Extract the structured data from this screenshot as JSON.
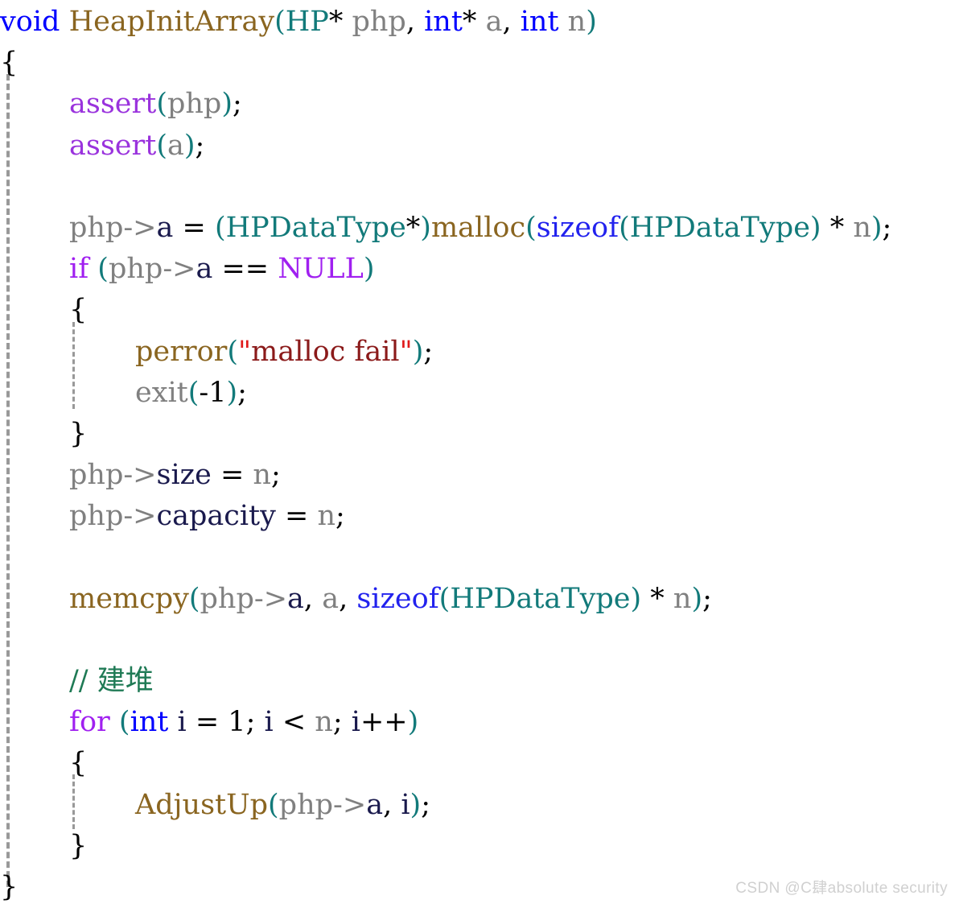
{
  "editor": {
    "language": "C",
    "background": "#ffffff",
    "font_size_px": 35,
    "line_height_px": 51.2,
    "indent_guide_color": "#999999"
  },
  "palette": {
    "keyword": "#0000ff",
    "control": "#a020f0",
    "macro": "#9a33dd",
    "function": "#8a6520",
    "type": "#127a7a",
    "variable": "#808080",
    "member": "#1a1a4d",
    "punctuation": "#000000",
    "sizeof": "#2222ee",
    "string": "#8b1a1a",
    "string_quote": "#e01b1b",
    "comment": "#1f7a55",
    "watermark": "#d0d0d0"
  },
  "watermark": {
    "text": "CSDN @C肆absolute security"
  },
  "code": {
    "plain_text": "void HeapInitArray(HP* php, int* a, int n)\n{\n    assert(php);\n    assert(a);\n\n    php->a = (HPDataType*)malloc(sizeof(HPDataType) * n);\n    if (php->a == NULL)\n    {\n        perror(\"malloc fail\");\n        exit(-1);\n    }\n    php->size = n;\n    php->capacity = n;\n\n    memcpy(php->a, a, sizeof(HPDataType) * n);\n\n    // 建堆\n    for (int i = 1; i < n; i++)\n    {\n        AdjustUp(php->a, i);\n    }\n}",
    "lines": [
      {
        "indent": 0,
        "tokens": [
          {
            "text": "void",
            "kind": "keyword"
          },
          {
            "text": " ",
            "kind": "plain"
          },
          {
            "text": "HeapInitArray",
            "kind": "function"
          },
          {
            "text": "(",
            "kind": "paren"
          },
          {
            "text": "HP",
            "kind": "type"
          },
          {
            "text": "*",
            "kind": "punct"
          },
          {
            "text": " ",
            "kind": "plain"
          },
          {
            "text": "php",
            "kind": "var"
          },
          {
            "text": ", ",
            "kind": "punct"
          },
          {
            "text": "int",
            "kind": "keyword"
          },
          {
            "text": "*",
            "kind": "punct"
          },
          {
            "text": " ",
            "kind": "plain"
          },
          {
            "text": "a",
            "kind": "var"
          },
          {
            "text": ", ",
            "kind": "punct"
          },
          {
            "text": "int",
            "kind": "keyword"
          },
          {
            "text": " ",
            "kind": "plain"
          },
          {
            "text": "n",
            "kind": "var"
          },
          {
            "text": ")",
            "kind": "paren"
          }
        ]
      },
      {
        "indent": 0,
        "tokens": [
          {
            "text": "{",
            "kind": "punct"
          }
        ]
      },
      {
        "indent": 1,
        "tokens": [
          {
            "text": "assert",
            "kind": "macro"
          },
          {
            "text": "(",
            "kind": "paren"
          },
          {
            "text": "php",
            "kind": "var"
          },
          {
            "text": ")",
            "kind": "paren"
          },
          {
            "text": ";",
            "kind": "punct"
          }
        ]
      },
      {
        "indent": 1,
        "tokens": [
          {
            "text": "assert",
            "kind": "macro"
          },
          {
            "text": "(",
            "kind": "paren"
          },
          {
            "text": "a",
            "kind": "var"
          },
          {
            "text": ")",
            "kind": "paren"
          },
          {
            "text": ";",
            "kind": "punct"
          }
        ]
      },
      {
        "indent": 0,
        "tokens": []
      },
      {
        "indent": 1,
        "tokens": [
          {
            "text": "php",
            "kind": "var"
          },
          {
            "text": "->",
            "kind": "var"
          },
          {
            "text": "a",
            "kind": "member"
          },
          {
            "text": " = ",
            "kind": "punct"
          },
          {
            "text": "(",
            "kind": "paren"
          },
          {
            "text": "HPDataType",
            "kind": "type"
          },
          {
            "text": "*",
            "kind": "punct"
          },
          {
            "text": ")",
            "kind": "paren"
          },
          {
            "text": "malloc",
            "kind": "function"
          },
          {
            "text": "(",
            "kind": "paren"
          },
          {
            "text": "sizeof",
            "kind": "sizeof"
          },
          {
            "text": "(",
            "kind": "paren"
          },
          {
            "text": "HPDataType",
            "kind": "type"
          },
          {
            "text": ")",
            "kind": "paren"
          },
          {
            "text": " * ",
            "kind": "punct"
          },
          {
            "text": "n",
            "kind": "var"
          },
          {
            "text": ")",
            "kind": "paren"
          },
          {
            "text": ";",
            "kind": "punct"
          }
        ]
      },
      {
        "indent": 1,
        "tokens": [
          {
            "text": "if",
            "kind": "control"
          },
          {
            "text": " ",
            "kind": "plain"
          },
          {
            "text": "(",
            "kind": "paren"
          },
          {
            "text": "php",
            "kind": "var"
          },
          {
            "text": "->",
            "kind": "var"
          },
          {
            "text": "a",
            "kind": "member"
          },
          {
            "text": " == ",
            "kind": "punct"
          },
          {
            "text": "NULL",
            "kind": "null"
          },
          {
            "text": ")",
            "kind": "paren"
          }
        ]
      },
      {
        "indent": 1,
        "tokens": [
          {
            "text": "{",
            "kind": "punct"
          }
        ]
      },
      {
        "indent": 2,
        "tokens": [
          {
            "text": "perror",
            "kind": "function"
          },
          {
            "text": "(",
            "kind": "paren"
          },
          {
            "text": "\"",
            "kind": "quote"
          },
          {
            "text": "malloc fail",
            "kind": "string"
          },
          {
            "text": "\"",
            "kind": "quote"
          },
          {
            "text": ")",
            "kind": "paren"
          },
          {
            "text": ";",
            "kind": "punct"
          }
        ]
      },
      {
        "indent": 2,
        "tokens": [
          {
            "text": "exit",
            "kind": "var"
          },
          {
            "text": "(",
            "kind": "paren"
          },
          {
            "text": "-1",
            "kind": "punct"
          },
          {
            "text": ")",
            "kind": "paren"
          },
          {
            "text": ";",
            "kind": "punct"
          }
        ]
      },
      {
        "indent": 1,
        "tokens": [
          {
            "text": "}",
            "kind": "punct"
          }
        ]
      },
      {
        "indent": 1,
        "tokens": [
          {
            "text": "php",
            "kind": "var"
          },
          {
            "text": "->",
            "kind": "var"
          },
          {
            "text": "size",
            "kind": "member"
          },
          {
            "text": " = ",
            "kind": "punct"
          },
          {
            "text": "n",
            "kind": "var"
          },
          {
            "text": ";",
            "kind": "punct"
          }
        ]
      },
      {
        "indent": 1,
        "tokens": [
          {
            "text": "php",
            "kind": "var"
          },
          {
            "text": "->",
            "kind": "var"
          },
          {
            "text": "capacity",
            "kind": "member"
          },
          {
            "text": " = ",
            "kind": "punct"
          },
          {
            "text": "n",
            "kind": "var"
          },
          {
            "text": ";",
            "kind": "punct"
          }
        ]
      },
      {
        "indent": 0,
        "tokens": []
      },
      {
        "indent": 1,
        "tokens": [
          {
            "text": "memcpy",
            "kind": "function"
          },
          {
            "text": "(",
            "kind": "paren"
          },
          {
            "text": "php",
            "kind": "var"
          },
          {
            "text": "->",
            "kind": "var"
          },
          {
            "text": "a",
            "kind": "member"
          },
          {
            "text": ", ",
            "kind": "punct"
          },
          {
            "text": "a",
            "kind": "var"
          },
          {
            "text": ", ",
            "kind": "punct"
          },
          {
            "text": "sizeof",
            "kind": "sizeof"
          },
          {
            "text": "(",
            "kind": "paren"
          },
          {
            "text": "HPDataType",
            "kind": "type"
          },
          {
            "text": ")",
            "kind": "paren"
          },
          {
            "text": " * ",
            "kind": "punct"
          },
          {
            "text": "n",
            "kind": "var"
          },
          {
            "text": ")",
            "kind": "paren"
          },
          {
            "text": ";",
            "kind": "punct"
          }
        ]
      },
      {
        "indent": 0,
        "tokens": []
      },
      {
        "indent": 1,
        "tokens": [
          {
            "text": "// 建堆",
            "kind": "comment"
          }
        ]
      },
      {
        "indent": 1,
        "tokens": [
          {
            "text": "for",
            "kind": "control"
          },
          {
            "text": " ",
            "kind": "plain"
          },
          {
            "text": "(",
            "kind": "paren"
          },
          {
            "text": "int",
            "kind": "keyword"
          },
          {
            "text": " ",
            "kind": "plain"
          },
          {
            "text": "i",
            "kind": "member"
          },
          {
            "text": " = ",
            "kind": "punct"
          },
          {
            "text": "1",
            "kind": "punct"
          },
          {
            "text": "; ",
            "kind": "punct"
          },
          {
            "text": "i",
            "kind": "member"
          },
          {
            "text": " < ",
            "kind": "punct"
          },
          {
            "text": "n",
            "kind": "var"
          },
          {
            "text": "; ",
            "kind": "punct"
          },
          {
            "text": "i",
            "kind": "member"
          },
          {
            "text": "++",
            "kind": "punct"
          },
          {
            "text": ")",
            "kind": "paren"
          }
        ]
      },
      {
        "indent": 1,
        "tokens": [
          {
            "text": "{",
            "kind": "punct"
          }
        ]
      },
      {
        "indent": 2,
        "tokens": [
          {
            "text": "AdjustUp",
            "kind": "function"
          },
          {
            "text": "(",
            "kind": "paren"
          },
          {
            "text": "php",
            "kind": "var"
          },
          {
            "text": "->",
            "kind": "var"
          },
          {
            "text": "a",
            "kind": "member"
          },
          {
            "text": ", ",
            "kind": "punct"
          },
          {
            "text": "i",
            "kind": "member"
          },
          {
            "text": ")",
            "kind": "paren"
          },
          {
            "text": ";",
            "kind": "punct"
          }
        ]
      },
      {
        "indent": 1,
        "tokens": [
          {
            "text": "}",
            "kind": "punct"
          }
        ]
      },
      {
        "indent": 0,
        "tokens": [
          {
            "text": "}",
            "kind": "punct"
          }
        ]
      }
    ]
  }
}
